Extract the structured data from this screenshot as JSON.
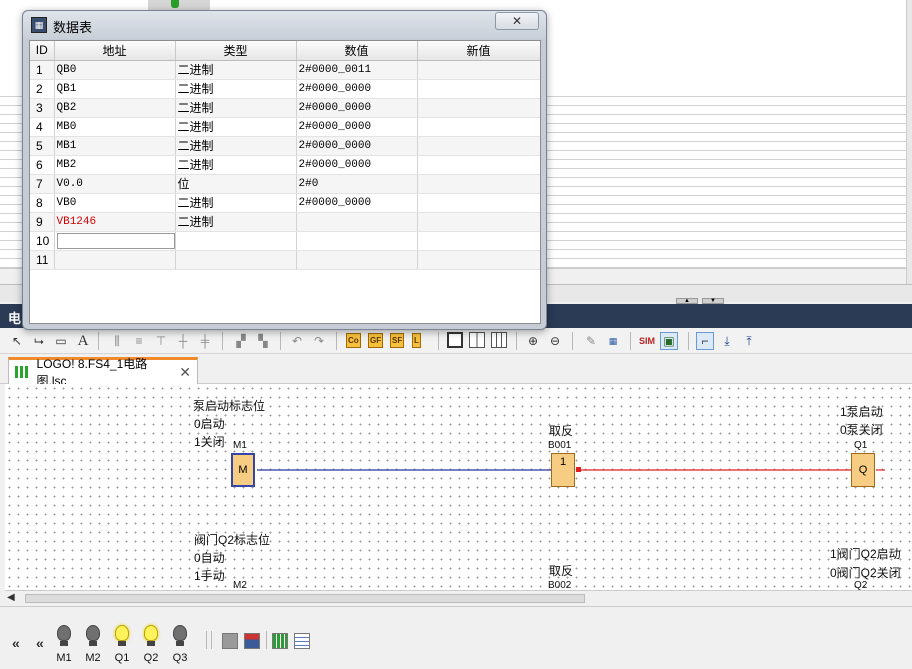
{
  "dialog": {
    "title": "数据表",
    "close_glyph": "✕",
    "columns": [
      "ID",
      "地址",
      "类型",
      "数值",
      "新值"
    ],
    "rows": [
      {
        "id": "1",
        "address": "QB0",
        "type": "二进制",
        "value": "2#0000_0011",
        "new": ""
      },
      {
        "id": "2",
        "address": "QB1",
        "type": "二进制",
        "value": "2#0000_0000",
        "new": ""
      },
      {
        "id": "3",
        "address": "QB2",
        "type": "二进制",
        "value": "2#0000_0000",
        "new": ""
      },
      {
        "id": "4",
        "address": "MB0",
        "type": "二进制",
        "value": "2#0000_0000",
        "new": ""
      },
      {
        "id": "5",
        "address": "MB1",
        "type": "二进制",
        "value": "2#0000_0000",
        "new": ""
      },
      {
        "id": "6",
        "address": "MB2",
        "type": "二进制",
        "value": "2#0000_0000",
        "new": ""
      },
      {
        "id": "7",
        "address": "V0.0",
        "type": "位",
        "value": "2#0",
        "new": ""
      },
      {
        "id": "8",
        "address": "VB0",
        "type": "二进制",
        "value": "2#0000_0000",
        "new": ""
      },
      {
        "id": "9",
        "address": "VB1246",
        "type": "二进制",
        "value": "",
        "new": "",
        "error": true
      },
      {
        "id": "10",
        "address": "",
        "type": "",
        "value": "",
        "new": "",
        "editing": true
      },
      {
        "id": "11",
        "address": "",
        "type": "",
        "value": "",
        "new": ""
      }
    ]
  },
  "panel_header": {
    "title": "电"
  },
  "tab": {
    "label": "LOGO! 8.FS4_1电路图.lsc",
    "close_glyph": "✕"
  },
  "toolbar": {
    "labels": [
      "Co",
      "GF",
      "SF",
      "L"
    ]
  },
  "canvas": {
    "texts": {
      "pump_flag": "泵启动标志位",
      "auto0": "0启动",
      "close1": "1关闭",
      "m1": "M1",
      "m1_block": "M",
      "invert1": "取反",
      "b001": "B001",
      "b001_block": "1",
      "pump_on": "1泵启动",
      "pump_off": "0泵关闭",
      "q1": "Q1",
      "q1_block": "Q",
      "valve_flag": "阀门Q2标志位",
      "auto": "0自动",
      "manual": "1手动",
      "m2": "M2",
      "invert2": "取反",
      "b002": "B002",
      "valve_on": "1阀门Q2启动",
      "valve_off": "0阀门Q2关闭",
      "q2": "Q2"
    },
    "colors": {
      "wire_m1": "#2b35a8",
      "wire_b001": "#e02020",
      "block_fill": "#f7cd83"
    }
  },
  "bottom_bar": {
    "nav_left": "«",
    "nav_left2": "«",
    "lamps": [
      {
        "label": "M1",
        "on": false
      },
      {
        "label": "M2",
        "on": false
      },
      {
        "label": "Q1",
        "on": true
      },
      {
        "label": "Q2",
        "on": true
      },
      {
        "label": "Q3",
        "on": false
      }
    ]
  }
}
